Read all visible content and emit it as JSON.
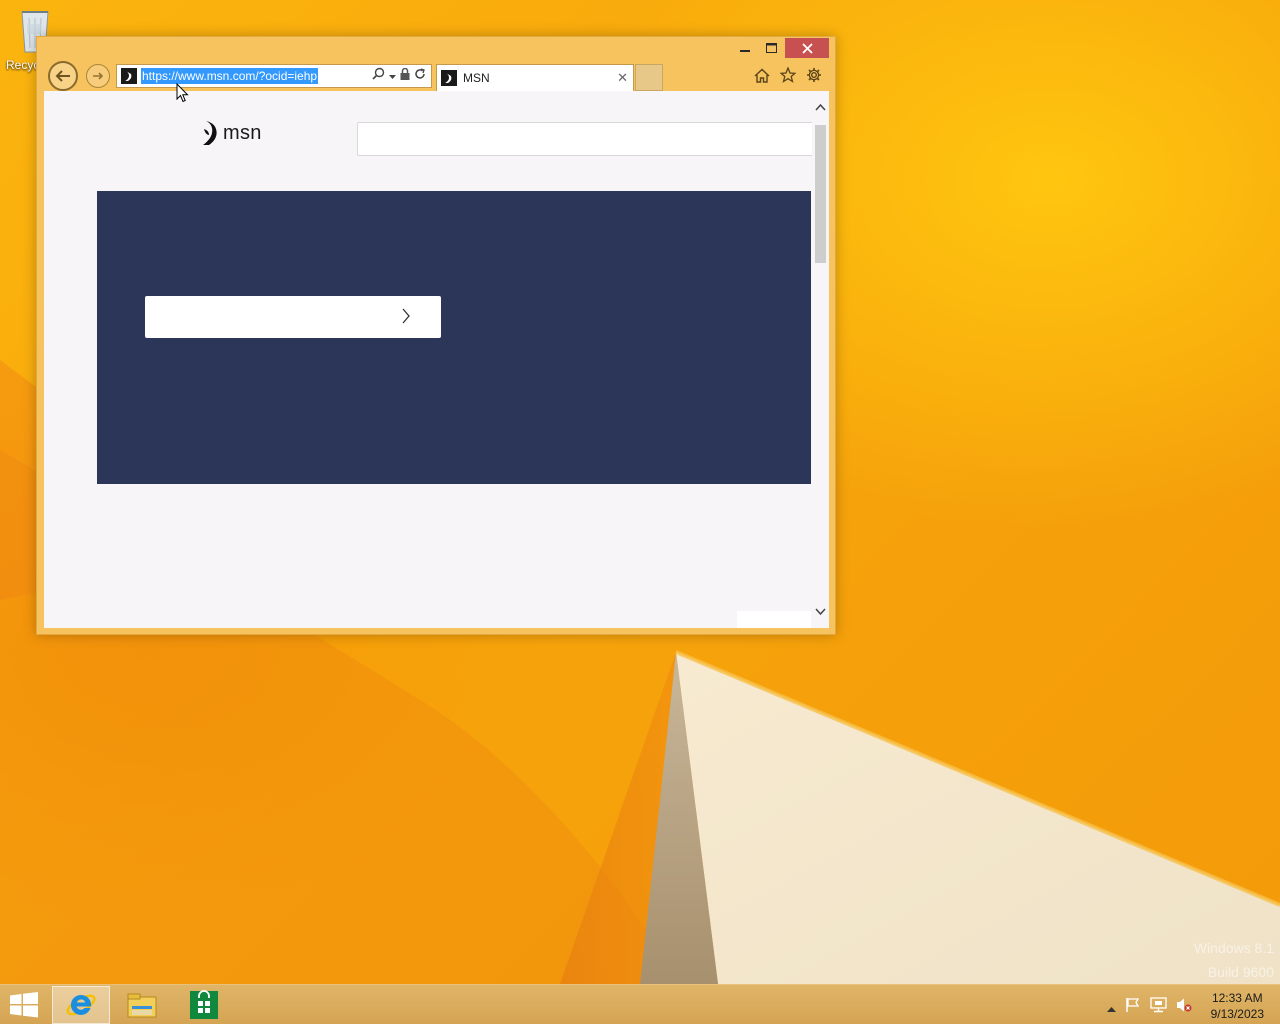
{
  "desktop": {
    "recycle_bin_label": "Recyc",
    "watermark_line1": "Windows 8.1",
    "watermark_line2": "Build 9600"
  },
  "browser": {
    "window_controls": {
      "minimize": "—",
      "maximize": "☐",
      "close": "✕"
    },
    "address_url": "https://www.msn.com/?ocid=iehp",
    "tab_title": "MSN",
    "tab_close": "✕"
  },
  "page": {
    "logo_text": "msn",
    "search_placeholder": "",
    "hero_color": "#2b3659"
  },
  "taskbar": {
    "apps": [
      "start-button",
      "internet-explorer",
      "file-explorer",
      "store"
    ],
    "time": "12:33 AM",
    "date": "9/13/2023"
  },
  "colors": {
    "window_frame": "#f6c35f",
    "url_selection": "#3399ff",
    "close_button": "#c75050"
  }
}
